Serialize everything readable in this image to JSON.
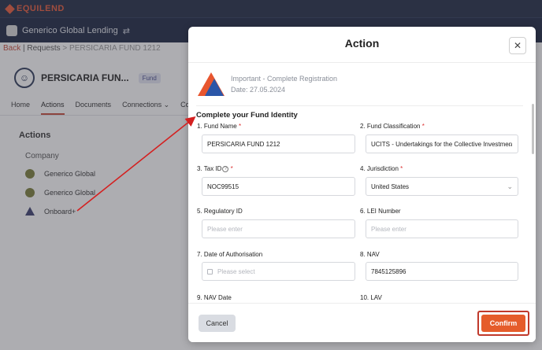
{
  "app": {
    "logo_text": "EQUILEND"
  },
  "org": {
    "name": "Generico Global Lending"
  },
  "breadcrumb": {
    "back": "Back",
    "separator": " | ",
    "section": "Requests",
    "current": " > PERSICARIA FUND 1212"
  },
  "fund": {
    "name": "PERSICARIA FUN...",
    "tag": "Fund"
  },
  "tabs": [
    "Home",
    "Actions",
    "Documents",
    "Connections",
    "Correspo"
  ],
  "connections_chevron": "⌄",
  "actions_panel": {
    "title": "Actions",
    "company_title": "Company",
    "rows": [
      "Generico Global",
      "Generico Global",
      "Onboard+"
    ]
  },
  "modal": {
    "title": "Action",
    "close": "✕",
    "notice": {
      "line1": "Important - Complete Registration",
      "line2": "Date: 27.05.2024"
    },
    "section_title": "Complete your Fund Identity",
    "fields": {
      "fund_name": {
        "label": "1. Fund Name",
        "req": "*",
        "value": "PERSICARIA FUND 1212"
      },
      "fund_class": {
        "label": "2. Fund Classification",
        "req": "*",
        "value": "UCITS - Undertakings for the Collective Investmen"
      },
      "tax_id": {
        "label": "3. Tax ID",
        "info": "?",
        "req": "*",
        "value": "NOC99515"
      },
      "jurisdiction": {
        "label": "4. Jurisdiction",
        "req": "*",
        "value": "United States"
      },
      "regulatory_id": {
        "label": "5. Regulatory ID",
        "placeholder": "Please enter"
      },
      "lei": {
        "label": "6. LEI Number",
        "placeholder": "Please enter"
      },
      "auth_date": {
        "label": "7. Date of Authorisation",
        "placeholder": "Please select"
      },
      "nav": {
        "label": "8. NAV",
        "value": "7845125896"
      },
      "nav_date": {
        "label": "9. NAV Date"
      },
      "lav": {
        "label": "10. LAV"
      }
    },
    "cancel_label": "Cancel",
    "confirm_label": "Confirm"
  },
  "colors": {
    "accent": "#e55c2b",
    "highlight": "#c0392b",
    "arrow": "#d42020",
    "nav": "#1f2a44"
  }
}
